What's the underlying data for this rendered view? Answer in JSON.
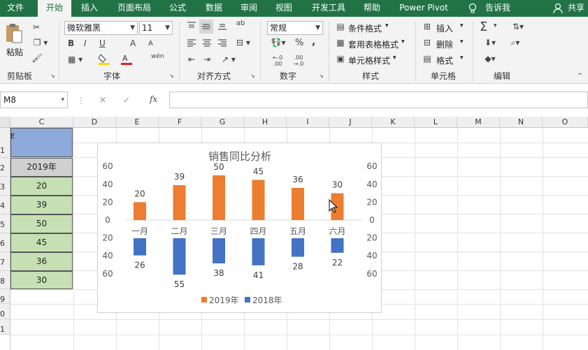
{
  "ribbon_tabs": [
    "文件",
    "开始",
    "插入",
    "页面布局",
    "公式",
    "数据",
    "审阅",
    "视图",
    "开发工具",
    "帮助",
    "Power Pivot",
    "告诉我",
    "共享"
  ],
  "clipboard": {
    "paste": "粘贴",
    "label": "剪贴板"
  },
  "font": {
    "name": "微软雅黑",
    "size": "11",
    "label": "字体",
    "bold": "B",
    "italic": "I",
    "underline": "U",
    "grow": "A",
    "shrink": "A",
    "phonetic": "wén"
  },
  "align": {
    "label": "对齐方式",
    "wrap": "ab"
  },
  "number": {
    "format": "常规",
    "label": "数字",
    "percent": "%",
    "comma": ",",
    "inc": "←.0 .00",
    "dec": ".00 →.0"
  },
  "styles": {
    "conditional": "条件格式",
    "table": "套用表格格式",
    "cell": "单元格样式",
    "label": "样式"
  },
  "cells": {
    "insert": "插入",
    "delete": "删除",
    "format": "格式",
    "label": "单元格"
  },
  "editing": {
    "label": "编辑",
    "sum": "Σ"
  },
  "formula_bar": {
    "name_box": "M8",
    "cancel": "✕",
    "enter": "✓",
    "fx": "fx",
    "content": ""
  },
  "columns": [
    "C",
    "D",
    "E",
    "F",
    "G",
    "H",
    "I",
    "J",
    "K",
    "L",
    "M",
    "N",
    "O"
  ],
  "rows": [
    "1",
    "2",
    "3",
    "4",
    "5",
    "6",
    "7",
    "8",
    "9",
    "0",
    "1"
  ],
  "cell_c1": "",
  "cell_partial": "E",
  "table": {
    "header": "2019年",
    "values": [
      "20",
      "39",
      "50",
      "45",
      "36",
      "30"
    ]
  },
  "colors": {
    "green": "#217346",
    "orange": "#ed7d31",
    "blue": "#4472c4",
    "header_blue": "#8eaadb",
    "cell_green": "#c6e0b4",
    "cell_gray": "#d0d0d0"
  },
  "chart_data": {
    "type": "bar",
    "title": "销售同比分析",
    "categories": [
      "一月",
      "二月",
      "三月",
      "四月",
      "五月",
      "六月"
    ],
    "series": [
      {
        "name": "2019年",
        "values": [
          20,
          39,
          50,
          45,
          36,
          30
        ],
        "color": "#ed7d31",
        "direction": "up"
      },
      {
        "name": "2018年",
        "values": [
          26,
          55,
          38,
          41,
          28,
          22
        ],
        "color": "#4472c4",
        "direction": "down"
      }
    ],
    "y_ticks": [
      "60",
      "40",
      "20",
      "0",
      "20",
      "40",
      "60"
    ],
    "ylim": [
      -60,
      60
    ],
    "legend": "bottom",
    "grid": false
  }
}
